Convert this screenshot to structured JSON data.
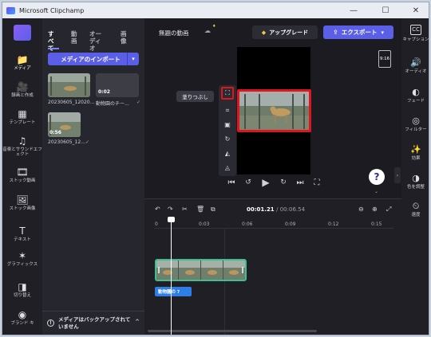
{
  "window": {
    "title": "Microsoft Clipchamp",
    "minimize": "—",
    "maximize": "☐",
    "close": "✕"
  },
  "leftnav": [
    {
      "label": "メディア",
      "icon": "📁"
    },
    {
      "label": "録画と作成",
      "icon": "🎥"
    },
    {
      "label": "テンプレート",
      "icon": "▦"
    },
    {
      "label": "音楽とサウンドエフェクト",
      "icon": "♫"
    },
    {
      "label": "ストック動画",
      "icon": "🎞"
    },
    {
      "label": "ストック画像",
      "icon": "🖼"
    },
    {
      "label": "テキスト",
      "icon": "T"
    },
    {
      "label": "グラフィックス",
      "icon": "✶"
    },
    {
      "label": "切り替え",
      "icon": "◨"
    },
    {
      "label": "ブランド キ",
      "icon": "◉"
    }
  ],
  "media": {
    "tabs": [
      "すべて",
      "動画",
      "オーディオ",
      "画像"
    ],
    "import_label": "メディアのインポート",
    "items": [
      {
        "caption": "20230605_12020…",
        "duration": ""
      },
      {
        "caption": "動物園のチー…",
        "duration": "0:02"
      },
      {
        "caption": "20230605_12…",
        "duration": "0:56"
      }
    ],
    "backup_text": "メディアはバックアップされていません"
  },
  "header": {
    "project_title": "無題の動画",
    "upgrade_label": "アップグレード",
    "export_label": "エクスポート"
  },
  "preview": {
    "tooltip": "塗りつぶし",
    "aspect_ratio": "9:16"
  },
  "timeline": {
    "current_time": "00:01.21",
    "total_time": "00:06.54",
    "ticks": [
      "0",
      "0:03",
      "0:06",
      "0:09",
      "0:12",
      "0:15"
    ],
    "text_clip_label": "動物園の ?"
  },
  "rightnav": [
    {
      "label": "キャプション",
      "icon": "CC"
    },
    {
      "label": "オーディオ",
      "icon": "🔊"
    },
    {
      "label": "フェード",
      "icon": "◐"
    },
    {
      "label": "フィルター",
      "icon": "◎"
    },
    {
      "label": "効果",
      "icon": "✨"
    },
    {
      "label": "色を調整",
      "icon": "◑"
    },
    {
      "label": "速度",
      "icon": "⏲"
    }
  ],
  "colors": {
    "accent": "#5b5fe8",
    "highlight": "#e0141e",
    "clip_border": "#3fbf8f",
    "text_clip": "#2f7de6"
  }
}
